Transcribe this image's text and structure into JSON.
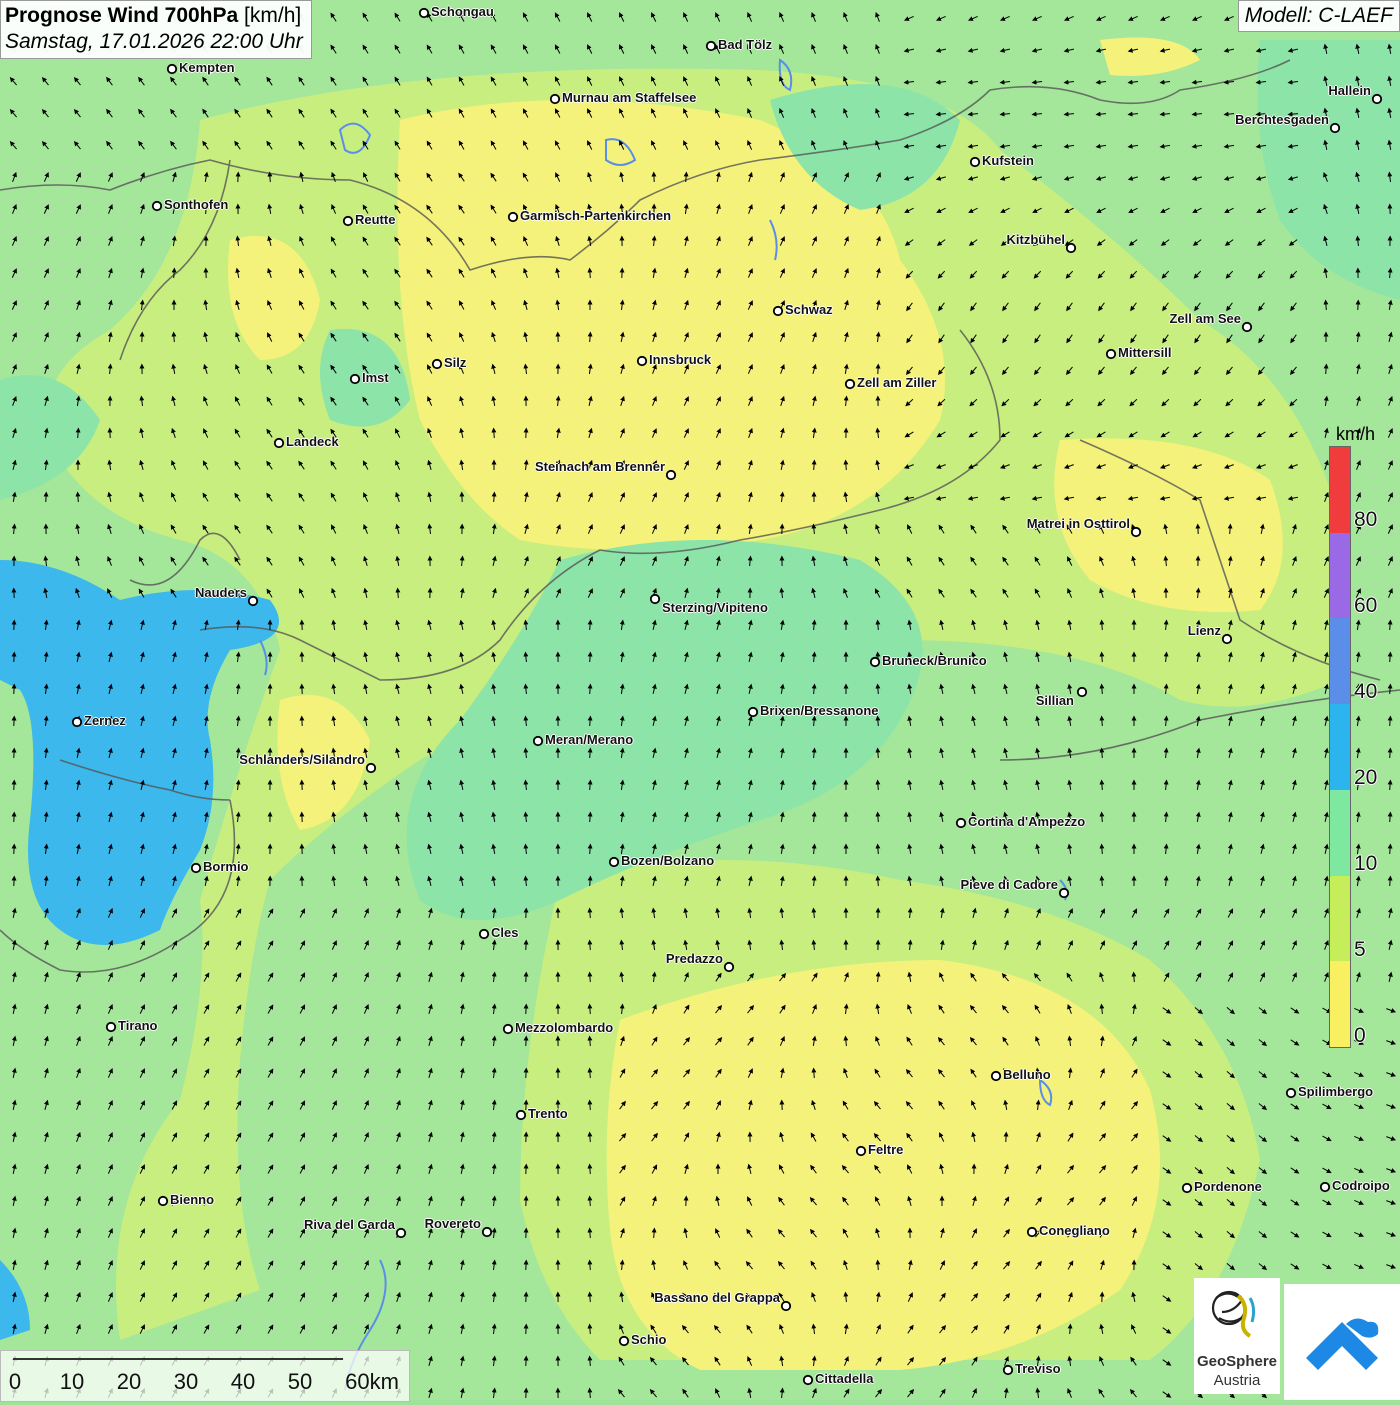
{
  "header": {
    "title_bold": "Prognose Wind 700hPa",
    "title_unit": "[km/h]",
    "datetime": "Samstag, 17.01.2026 22:00 Uhr",
    "model": "Modell: C-LAEF"
  },
  "legend": {
    "unit": "km/h",
    "ticks": [
      "80",
      "60",
      "40",
      "20",
      "10",
      "5",
      "0"
    ],
    "colors": [
      "#f03c3c",
      "#9a6ae6",
      "#5a8ee8",
      "#2cb4ee",
      "#7ee8a0",
      "#c6ee5a",
      "#f8f060"
    ]
  },
  "scale_bar": {
    "labels": [
      "0",
      "10",
      "20",
      "30",
      "40",
      "50",
      "60km"
    ]
  },
  "cities": [
    {
      "name": "Schongau"
    },
    {
      "name": "Bad Tölz"
    },
    {
      "name": "Kempten"
    },
    {
      "name": "Murnau am Staffelsee"
    },
    {
      "name": "Hallein"
    },
    {
      "name": "Berchtesgaden"
    },
    {
      "name": "Kufstein"
    },
    {
      "name": "Sonthofen"
    },
    {
      "name": "Reutte"
    },
    {
      "name": "Garmisch-Partenkirchen"
    },
    {
      "name": "Kitzbühel"
    },
    {
      "name": "Schwaz"
    },
    {
      "name": "Zell am See"
    },
    {
      "name": "Mittersill"
    },
    {
      "name": "Silz"
    },
    {
      "name": "Innsbruck"
    },
    {
      "name": "Imst"
    },
    {
      "name": "Zell am Ziller"
    },
    {
      "name": "Landeck"
    },
    {
      "name": "Steinach am Brenner"
    },
    {
      "name": "Matrei in Osttirol"
    },
    {
      "name": "Nauders"
    },
    {
      "name": "Sterzing/Vipiteno"
    },
    {
      "name": "Lienz"
    },
    {
      "name": "Bruneck/Brunico"
    },
    {
      "name": "Sillian"
    },
    {
      "name": "Zernez"
    },
    {
      "name": "Brixen/Bressanone"
    },
    {
      "name": "Meran/Merano"
    },
    {
      "name": "Schlanders/Silandro"
    },
    {
      "name": "Cortina d'Ampezzo"
    },
    {
      "name": "Bozen/Bolzano"
    },
    {
      "name": "Bormio"
    },
    {
      "name": "Pieve di Cadore"
    },
    {
      "name": "Cles"
    },
    {
      "name": "Predazzo"
    },
    {
      "name": "Tirano"
    },
    {
      "name": "Mezzolombardo"
    },
    {
      "name": "Belluno"
    },
    {
      "name": "Spilimbergo"
    },
    {
      "name": "Trento"
    },
    {
      "name": "Feltre"
    },
    {
      "name": "Pordenone"
    },
    {
      "name": "Codroipo"
    },
    {
      "name": "Bienno"
    },
    {
      "name": "Riva del Garda"
    },
    {
      "name": "Rovereto"
    },
    {
      "name": "Conegliano"
    },
    {
      "name": "Bassano del Grappa"
    },
    {
      "name": "Schio"
    },
    {
      "name": "Treviso"
    },
    {
      "name": "Cittadella"
    }
  ],
  "logos": {
    "org_name_line1": "GeoSphere",
    "org_name_line2": "Austria"
  }
}
